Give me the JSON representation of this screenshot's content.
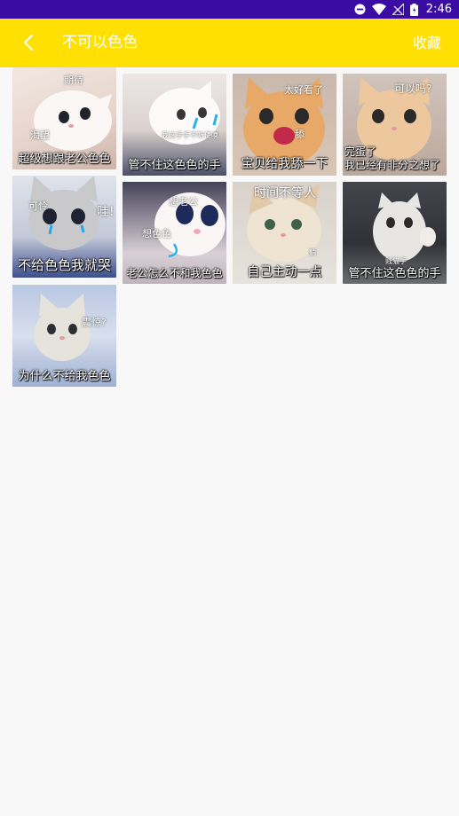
{
  "status_bar": {
    "time": "2:46"
  },
  "app_bar": {
    "title": "不可以色色",
    "favorite_label": "收藏"
  },
  "stickers": [
    {
      "caption": "超级想跟老公色色",
      "notes": [
        "期待",
        "渴望"
      ]
    },
    {
      "caption": "管不住这色色的手",
      "notes": [
        "我这手手不听使唤"
      ]
    },
    {
      "caption": "宝贝给我舔一下",
      "notes": [
        "太好看了",
        "舔"
      ]
    },
    {
      "caption": "完蛋了\n我已经有非分之想了",
      "notes": [
        "可以吗?"
      ]
    },
    {
      "caption": "不给色色我就哭",
      "notes": [
        "可怜",
        "哇!"
      ]
    },
    {
      "caption": "老公怎么不和我色色",
      "notes": [
        "想老公",
        "想色色"
      ]
    },
    {
      "caption": "自己主动一点",
      "notes": [
        "时间不等人",
        "躺"
      ]
    },
    {
      "caption": "管不住这色色的手",
      "notes": [
        "贱猫手"
      ]
    },
    {
      "caption": "为什么不给我色色",
      "notes": [
        "震惊?"
      ]
    }
  ]
}
